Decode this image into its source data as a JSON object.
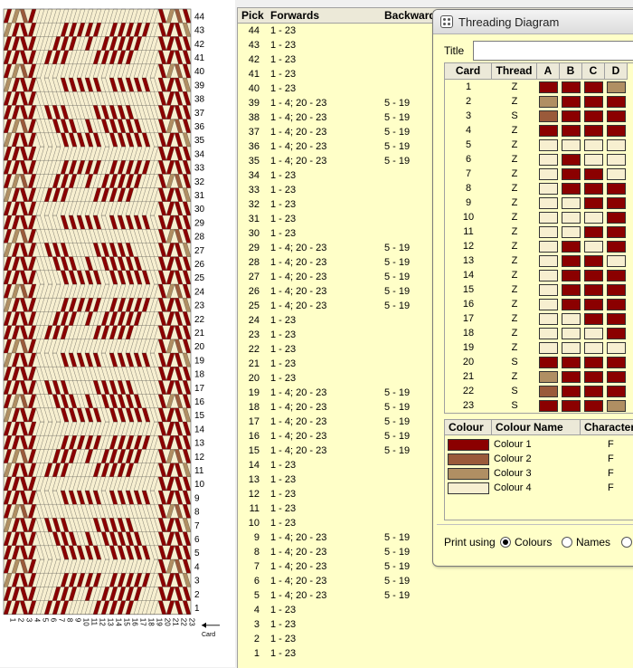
{
  "pattern": {
    "cards": 23,
    "picks": 44,
    "card_labels": [
      "1",
      "2",
      "3",
      "4",
      "5",
      "6",
      "7",
      "8",
      "9",
      "10",
      "11",
      "12",
      "13",
      "14",
      "15",
      "16",
      "17",
      "18",
      "19",
      "20",
      "21",
      "22",
      "23"
    ],
    "pick_labels": [
      "1",
      "2",
      "3",
      "4",
      "5",
      "6",
      "7",
      "8",
      "9",
      "10",
      "11",
      "12",
      "13",
      "14",
      "15",
      "16",
      "17",
      "18",
      "19",
      "20",
      "21",
      "22",
      "23",
      "24",
      "25",
      "26",
      "27",
      "28",
      "29",
      "30",
      "31",
      "32",
      "33",
      "34",
      "35",
      "36",
      "37",
      "38",
      "39",
      "40",
      "41",
      "42",
      "43",
      "44"
    ],
    "card_axis_label": "Card"
  },
  "pick_table": {
    "headers": {
      "pick": "Pick",
      "forwards": "Forwards",
      "backwards": "Backward"
    },
    "rows": [
      {
        "pick": "44",
        "fwd": "1 - 23",
        "bwd": ""
      },
      {
        "pick": "43",
        "fwd": "1 - 23",
        "bwd": ""
      },
      {
        "pick": "42",
        "fwd": "1 - 23",
        "bwd": ""
      },
      {
        "pick": "41",
        "fwd": "1 - 23",
        "bwd": ""
      },
      {
        "pick": "40",
        "fwd": "1 - 23",
        "bwd": ""
      },
      {
        "pick": "39",
        "fwd": "1 - 4; 20 - 23",
        "bwd": "5 - 19"
      },
      {
        "pick": "38",
        "fwd": "1 - 4; 20 - 23",
        "bwd": "5 - 19"
      },
      {
        "pick": "37",
        "fwd": "1 - 4; 20 - 23",
        "bwd": "5 - 19"
      },
      {
        "pick": "36",
        "fwd": "1 - 4; 20 - 23",
        "bwd": "5 - 19"
      },
      {
        "pick": "35",
        "fwd": "1 - 4; 20 - 23",
        "bwd": "5 - 19"
      },
      {
        "pick": "34",
        "fwd": "1 - 23",
        "bwd": ""
      },
      {
        "pick": "33",
        "fwd": "1 - 23",
        "bwd": ""
      },
      {
        "pick": "32",
        "fwd": "1 - 23",
        "bwd": ""
      },
      {
        "pick": "31",
        "fwd": "1 - 23",
        "bwd": ""
      },
      {
        "pick": "30",
        "fwd": "1 - 23",
        "bwd": ""
      },
      {
        "pick": "29",
        "fwd": "1 - 4; 20 - 23",
        "bwd": "5 - 19"
      },
      {
        "pick": "28",
        "fwd": "1 - 4; 20 - 23",
        "bwd": "5 - 19"
      },
      {
        "pick": "27",
        "fwd": "1 - 4; 20 - 23",
        "bwd": "5 - 19"
      },
      {
        "pick": "26",
        "fwd": "1 - 4; 20 - 23",
        "bwd": "5 - 19"
      },
      {
        "pick": "25",
        "fwd": "1 - 4; 20 - 23",
        "bwd": "5 - 19"
      },
      {
        "pick": "24",
        "fwd": "1 - 23",
        "bwd": ""
      },
      {
        "pick": "23",
        "fwd": "1 - 23",
        "bwd": ""
      },
      {
        "pick": "22",
        "fwd": "1 - 23",
        "bwd": ""
      },
      {
        "pick": "21",
        "fwd": "1 - 23",
        "bwd": ""
      },
      {
        "pick": "20",
        "fwd": "1 - 23",
        "bwd": ""
      },
      {
        "pick": "19",
        "fwd": "1 - 4; 20 - 23",
        "bwd": "5 - 19"
      },
      {
        "pick": "18",
        "fwd": "1 - 4; 20 - 23",
        "bwd": "5 - 19"
      },
      {
        "pick": "17",
        "fwd": "1 - 4; 20 - 23",
        "bwd": "5 - 19"
      },
      {
        "pick": "16",
        "fwd": "1 - 4; 20 - 23",
        "bwd": "5 - 19"
      },
      {
        "pick": "15",
        "fwd": "1 - 4; 20 - 23",
        "bwd": "5 - 19"
      },
      {
        "pick": "14",
        "fwd": "1 - 23",
        "bwd": ""
      },
      {
        "pick": "13",
        "fwd": "1 - 23",
        "bwd": ""
      },
      {
        "pick": "12",
        "fwd": "1 - 23",
        "bwd": ""
      },
      {
        "pick": "11",
        "fwd": "1 - 23",
        "bwd": ""
      },
      {
        "pick": "10",
        "fwd": "1 - 23",
        "bwd": ""
      },
      {
        "pick": "9",
        "fwd": "1 - 4; 20 - 23",
        "bwd": "5 - 19"
      },
      {
        "pick": "8",
        "fwd": "1 - 4; 20 - 23",
        "bwd": "5 - 19"
      },
      {
        "pick": "7",
        "fwd": "1 - 4; 20 - 23",
        "bwd": "5 - 19"
      },
      {
        "pick": "6",
        "fwd": "1 - 4; 20 - 23",
        "bwd": "5 - 19"
      },
      {
        "pick": "5",
        "fwd": "1 - 4; 20 - 23",
        "bwd": "5 - 19"
      },
      {
        "pick": "4",
        "fwd": "1 - 23",
        "bwd": ""
      },
      {
        "pick": "3",
        "fwd": "1 - 23",
        "bwd": ""
      },
      {
        "pick": "2",
        "fwd": "1 - 23",
        "bwd": ""
      },
      {
        "pick": "1",
        "fwd": "1 - 23",
        "bwd": ""
      }
    ]
  },
  "dialog": {
    "title": "Threading Diagram",
    "title_field_label": "Title",
    "title_value": "",
    "grid_headers": {
      "card": "Card",
      "thread": "Thread",
      "a": "A",
      "b": "B",
      "c": "C",
      "d": "D"
    },
    "cards": [
      {
        "card": "1",
        "thread": "Z",
        "holes": [
          1,
          1,
          1,
          3
        ]
      },
      {
        "card": "2",
        "thread": "Z",
        "holes": [
          3,
          1,
          1,
          1
        ]
      },
      {
        "card": "3",
        "thread": "S",
        "holes": [
          2,
          1,
          1,
          1
        ]
      },
      {
        "card": "4",
        "thread": "Z",
        "holes": [
          1,
          1,
          1,
          1
        ]
      },
      {
        "card": "5",
        "thread": "Z",
        "holes": [
          4,
          4,
          4,
          4
        ]
      },
      {
        "card": "6",
        "thread": "Z",
        "holes": [
          4,
          1,
          4,
          4
        ]
      },
      {
        "card": "7",
        "thread": "Z",
        "holes": [
          4,
          1,
          1,
          4
        ]
      },
      {
        "card": "8",
        "thread": "Z",
        "holes": [
          4,
          1,
          1,
          1
        ]
      },
      {
        "card": "9",
        "thread": "Z",
        "holes": [
          4,
          4,
          1,
          1
        ]
      },
      {
        "card": "10",
        "thread": "Z",
        "holes": [
          4,
          4,
          4,
          1
        ]
      },
      {
        "card": "11",
        "thread": "Z",
        "holes": [
          4,
          4,
          1,
          1
        ]
      },
      {
        "card": "12",
        "thread": "Z",
        "holes": [
          4,
          1,
          4,
          1
        ]
      },
      {
        "card": "13",
        "thread": "Z",
        "holes": [
          4,
          1,
          1,
          4
        ]
      },
      {
        "card": "14",
        "thread": "Z",
        "holes": [
          4,
          1,
          1,
          1
        ]
      },
      {
        "card": "15",
        "thread": "Z",
        "holes": [
          4,
          1,
          1,
          1
        ]
      },
      {
        "card": "16",
        "thread": "Z",
        "holes": [
          4,
          1,
          1,
          1
        ]
      },
      {
        "card": "17",
        "thread": "Z",
        "holes": [
          4,
          4,
          1,
          1
        ]
      },
      {
        "card": "18",
        "thread": "Z",
        "holes": [
          4,
          4,
          4,
          1
        ]
      },
      {
        "card": "19",
        "thread": "Z",
        "holes": [
          4,
          4,
          4,
          4
        ]
      },
      {
        "card": "20",
        "thread": "S",
        "holes": [
          1,
          1,
          1,
          1
        ]
      },
      {
        "card": "21",
        "thread": "Z",
        "holes": [
          3,
          1,
          1,
          1
        ]
      },
      {
        "card": "22",
        "thread": "S",
        "holes": [
          2,
          1,
          1,
          1
        ]
      },
      {
        "card": "23",
        "thread": "S",
        "holes": [
          1,
          1,
          1,
          3
        ]
      }
    ],
    "colour_headers": {
      "colour": "Colour",
      "name": "Colour Name",
      "character": "Character"
    },
    "colours": [
      {
        "name": "Colour 1",
        "hex": "#8b0000",
        "char": "F"
      },
      {
        "name": "Colour 2",
        "hex": "#9a5a3a",
        "char": "F"
      },
      {
        "name": "Colour 3",
        "hex": "#b08f63",
        "char": "F"
      },
      {
        "name": "Colour 4",
        "hex": "#f7efd0",
        "char": "F"
      }
    ],
    "print_using_label": "Print using",
    "print_options": [
      {
        "label": "Colours",
        "selected": true
      },
      {
        "label": "Names",
        "selected": false
      }
    ]
  }
}
